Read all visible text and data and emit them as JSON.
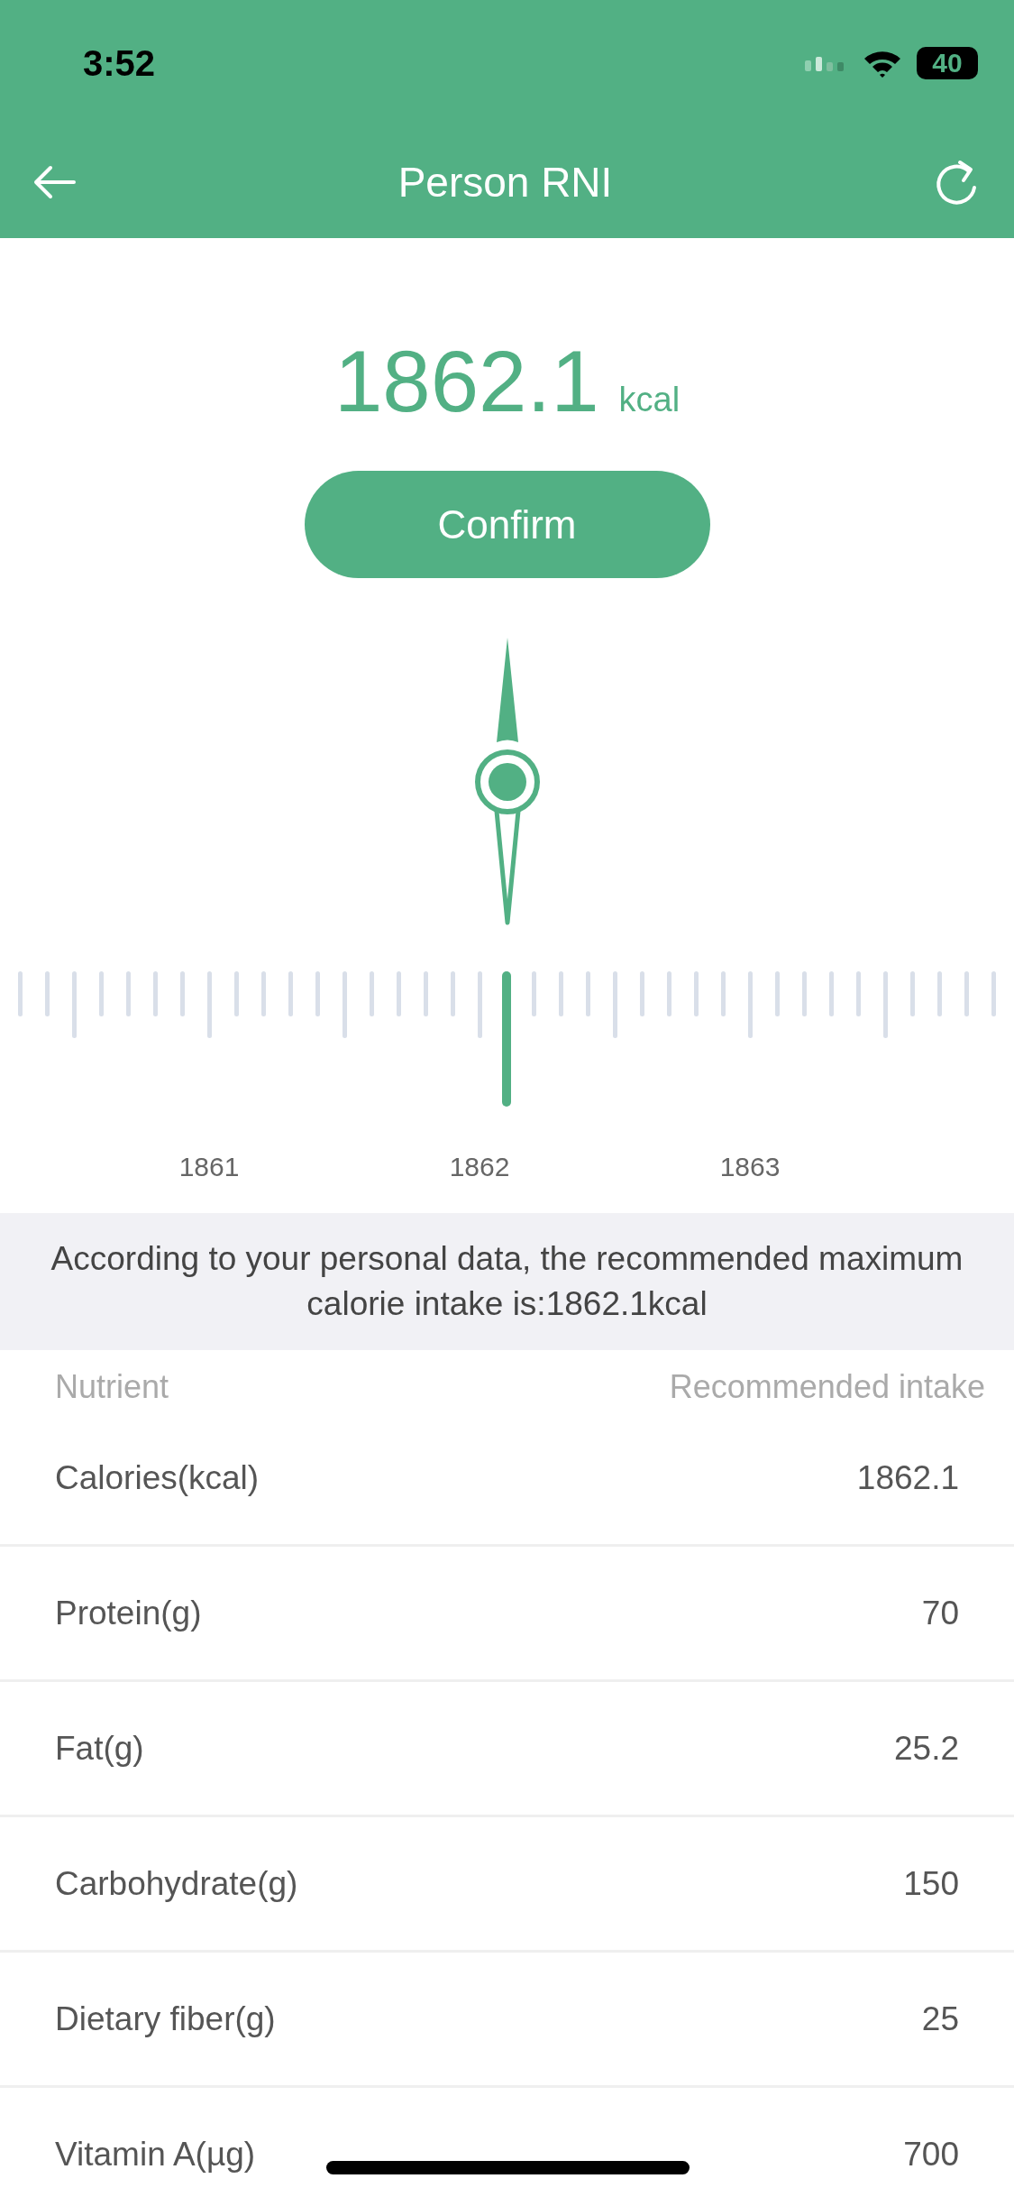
{
  "status_bar": {
    "time": "3:52",
    "battery": "40"
  },
  "header": {
    "title": "Person RNI"
  },
  "calorie": {
    "value": "1862.1",
    "unit": "kcal"
  },
  "confirm_button": "Confirm",
  "ruler": {
    "labels": [
      "1861",
      "1862",
      "1863"
    ]
  },
  "info": "According to your personal data, the recommended maximum calorie intake is:1862.1kcal",
  "table": {
    "columns": [
      "Nutrient",
      "Recommended intake"
    ],
    "rows": [
      {
        "name": "Calories(kcal)",
        "value": "1862.1"
      },
      {
        "name": "Protein(g)",
        "value": "70"
      },
      {
        "name": "Fat(g)",
        "value": "25.2"
      },
      {
        "name": "Carbohydrate(g)",
        "value": "150"
      },
      {
        "name": "Dietary fiber(g)",
        "value": "25"
      },
      {
        "name": "Vitamin A(µg)",
        "value": "700"
      }
    ]
  }
}
